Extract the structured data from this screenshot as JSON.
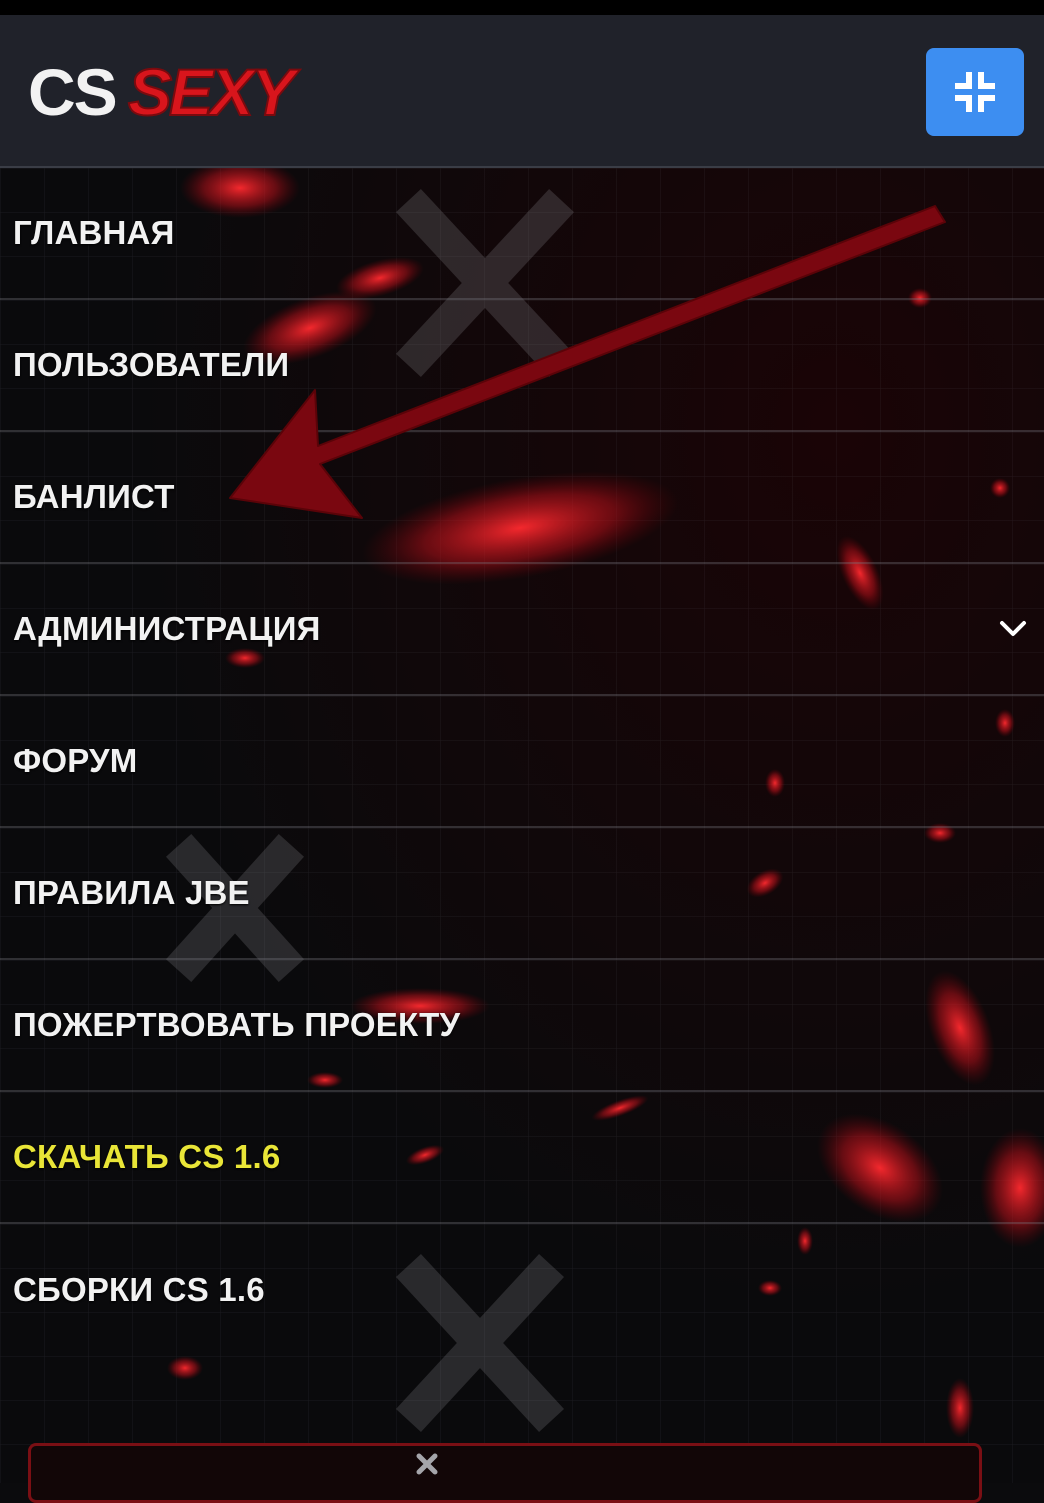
{
  "header": {
    "logo_text_part1": "CS",
    "logo_text_part2": "SEXY",
    "menu_toggle_icon": "collapse-icon"
  },
  "nav": {
    "items": [
      {
        "label": "ГЛАВНАЯ"
      },
      {
        "label": "ПОЛЬЗОВАТЕЛИ"
      },
      {
        "label": "БАНЛИСТ"
      },
      {
        "label": "АДМИНИСТРАЦИЯ",
        "icon": "chevron-down-icon"
      },
      {
        "label": "ФОРУМ"
      },
      {
        "label": "ПРАВИЛА JBE"
      },
      {
        "label": "ПОЖЕРТВОВАТЬ ПРОЕКТУ"
      },
      {
        "label": "СКАЧАТЬ CS 1.6",
        "highlight_color": "#e9e537"
      },
      {
        "label": "СБОРКИ CS 1.6"
      }
    ]
  },
  "annotation": {
    "arrow_color": "#7a0710"
  },
  "colors": {
    "header_bg": "#20222a",
    "toggle_bg": "#3d8ef1",
    "nav_text": "#f2f2f2",
    "highlight_text": "#e9e537"
  }
}
